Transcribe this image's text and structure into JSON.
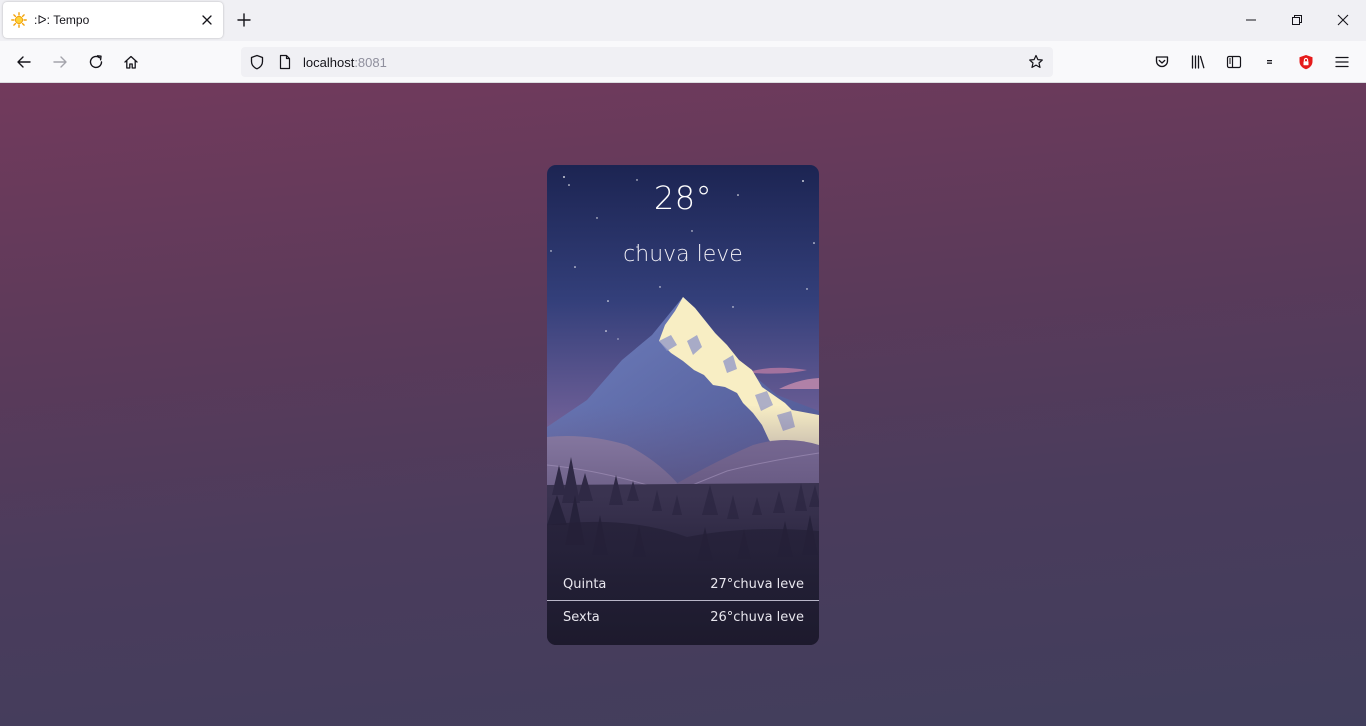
{
  "browser": {
    "tab": {
      "title": ":ᐅ: Tempo"
    },
    "url": {
      "host": "localhost",
      "port": ":8081"
    }
  },
  "weather": {
    "temperature": "28°",
    "condition": "chuva leve",
    "forecast": [
      {
        "day": "Quinta",
        "temp": "27°",
        "condition": "chuva leve"
      },
      {
        "day": "Sexta",
        "temp": "26°",
        "condition": "chuva leve"
      }
    ]
  },
  "colors": {
    "page_top": "#723a5c",
    "page_bottom": "#413e5c",
    "sky_top": "#1c2452",
    "sky_bottom": "#8a6b94",
    "snow": "#f8eec4",
    "card_bottom": "#1d1a2d"
  },
  "icons": [
    "sun-icon",
    "close-icon",
    "plus-icon",
    "minimize-icon",
    "restore-icon",
    "close-window-icon",
    "back-icon",
    "forward-icon",
    "reload-icon",
    "home-icon",
    "shield-icon",
    "page-icon",
    "star-icon",
    "pocket-icon",
    "library-icon",
    "sidebar-icon",
    "extension-icon",
    "ublock-icon",
    "menu-icon"
  ]
}
